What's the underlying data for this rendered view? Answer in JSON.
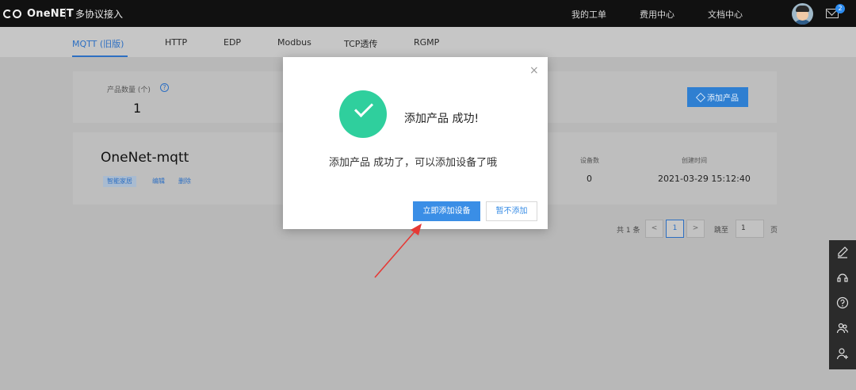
{
  "topbar": {
    "brand": "OneNET",
    "app_title": "多协议接入",
    "links": [
      "我的工单",
      "费用中心",
      "文档中心"
    ],
    "mail_count": "2"
  },
  "tabs": [
    "MQTT (旧版)",
    "HTTP",
    "EDP",
    "Modbus",
    "TCP透传",
    "RGMP"
  ],
  "summary": {
    "product_count_label": "产品数量 (个)",
    "product_count": "1",
    "help_glyph": "?",
    "add_product_label": "添加产品"
  },
  "product": {
    "name": "OneNet-mqtt",
    "tag": "智能家居",
    "edit_label": "编辑",
    "delete_label": "删除",
    "device_count_label": "设备数",
    "device_count": "0",
    "created_label": "创建时间",
    "created_value": "2021-03-29 15:12:40"
  },
  "pagination": {
    "total": "共 1 条",
    "prev": "<",
    "current_page": "1",
    "next": ">",
    "jump_label": "跳至",
    "jump_value": "1",
    "page_suffix": "页"
  },
  "modal": {
    "close_glyph": "×",
    "title": "添加产品 成功!",
    "message": "添加产品 成功了，可以添加设备了哦",
    "primary_button": "立即添加设备",
    "secondary_button": "暂不添加"
  },
  "side_toolbar": {
    "icons": [
      "edit-icon",
      "headset-icon",
      "help-icon",
      "users-icon",
      "add-user-icon"
    ]
  },
  "colors": {
    "primary": "#3a8ee6",
    "success": "#2fcf9d",
    "annotation_arrow": "#e53935"
  }
}
